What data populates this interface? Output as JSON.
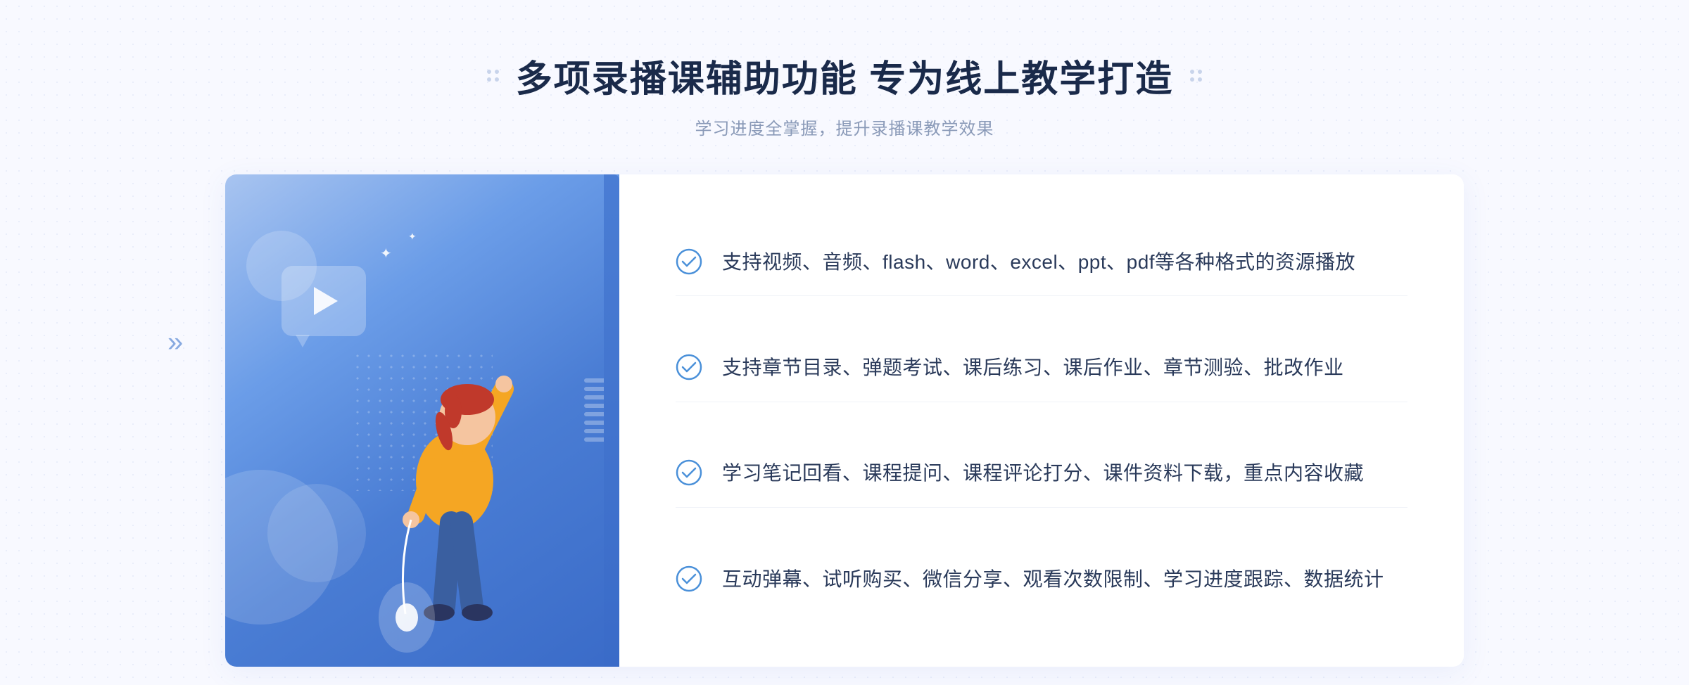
{
  "page": {
    "background_color": "#f0f4ff"
  },
  "header": {
    "title": "多项录播课辅助功能 专为线上教学打造",
    "subtitle": "学习进度全掌握，提升录播课教学效果",
    "title_dots_left": "decorative",
    "title_dots_right": "decorative"
  },
  "features": [
    {
      "id": 1,
      "text": "支持视频、音频、flash、word、excel、ppt、pdf等各种格式的资源播放"
    },
    {
      "id": 2,
      "text": "支持章节目录、弹题考试、课后练习、课后作业、章节测验、批改作业"
    },
    {
      "id": 3,
      "text": "学习笔记回看、课程提问、课程评论打分、课件资料下载，重点内容收藏"
    },
    {
      "id": 4,
      "text": "互动弹幕、试听购买、微信分享、观看次数限制、学习进度跟踪、数据统计"
    }
  ],
  "illustration": {
    "play_button": "▶",
    "sparkle": "✦",
    "chevron_left": "»"
  },
  "colors": {
    "primary_blue": "#4a7dd4",
    "light_blue": "#a8c4f0",
    "dark_text": "#1a2a4a",
    "body_text": "#2a3a5a",
    "subtitle_text": "#8a9ab8",
    "check_color": "#4a90d9",
    "border_color": "#f0f3f8"
  }
}
